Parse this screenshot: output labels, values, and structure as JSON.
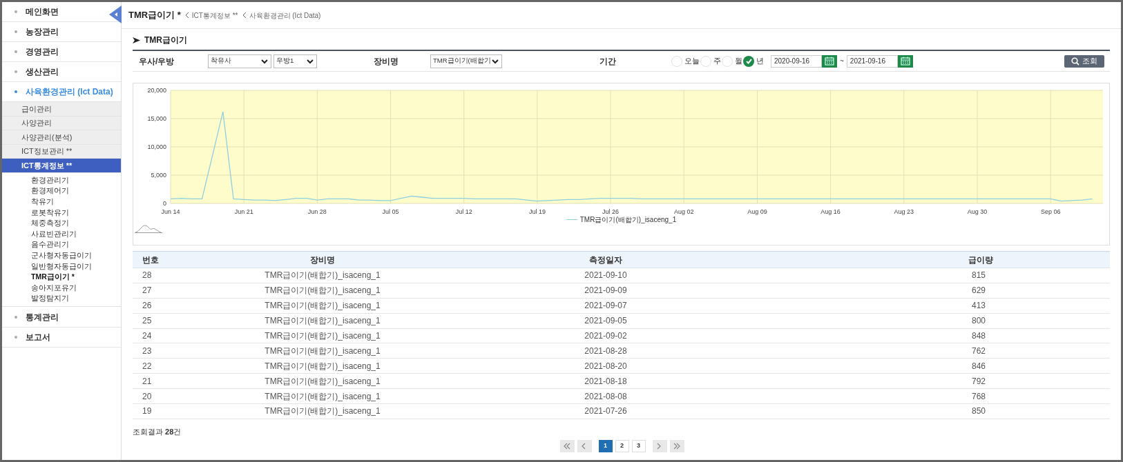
{
  "sidebar": {
    "items": [
      {
        "label": "메인화면",
        "selected": false
      },
      {
        "label": "농장관리",
        "selected": false
      },
      {
        "label": "경영관리",
        "selected": false
      },
      {
        "label": "생산관리",
        "selected": false
      },
      {
        "label": "사육환경관리 (Ict Data)",
        "selected": true,
        "children": [
          {
            "label": "급이관리",
            "selected": false
          },
          {
            "label": "사양관리",
            "selected": false
          },
          {
            "label": "사양관리(분석)",
            "selected": false
          },
          {
            "label": "ICT정보관리 **",
            "selected": false
          },
          {
            "label": "ICT통계정보 **",
            "selected": true,
            "children": [
              {
                "label": "환경관리기",
                "selected": false
              },
              {
                "label": "환경제어기",
                "selected": false
              },
              {
                "label": "착유기",
                "selected": false
              },
              {
                "label": "로봇착유기",
                "selected": false
              },
              {
                "label": "체중측정기",
                "selected": false
              },
              {
                "label": "사료빈관리기",
                "selected": false
              },
              {
                "label": "음수관리기",
                "selected": false
              },
              {
                "label": "군사형자동급이기",
                "selected": false
              },
              {
                "label": "일반형자동급이기",
                "selected": false
              },
              {
                "label": "TMR급이기 *",
                "selected": true
              },
              {
                "label": "송아지포유기",
                "selected": false
              },
              {
                "label": "발정탐지기",
                "selected": false
              }
            ]
          }
        ]
      },
      {
        "label": "통계관리",
        "selected": false
      },
      {
        "label": "보고서",
        "selected": false
      }
    ]
  },
  "header": {
    "title": "TMR급이기 *",
    "breadcrumb": [
      "ICT통계정보 **",
      "사육환경관리 (Ict Data)"
    ]
  },
  "section_title": "TMR급이기",
  "filters": {
    "barn_label": "우사/우방",
    "barn_select": "착유사",
    "room_select": "우방1",
    "device_label": "장비명",
    "device_select": "TMR급이기(배합기",
    "period_label": "기간",
    "period_options": [
      {
        "label": "오늘",
        "checked": false
      },
      {
        "label": "주",
        "checked": false
      },
      {
        "label": "월",
        "checked": false
      },
      {
        "label": "년",
        "checked": true
      }
    ],
    "date_from": "2020-09-16",
    "date_separator": "~",
    "date_to": "2021-09-16",
    "search_button": "조회"
  },
  "chart_data": {
    "type": "line",
    "categories": [
      "Jun 14",
      null,
      null,
      null,
      null,
      null,
      null,
      "Jun 21",
      null,
      null,
      null,
      null,
      null,
      null,
      "Jun 28",
      null,
      null,
      null,
      null,
      null,
      null,
      "Jul 05",
      null,
      null,
      null,
      null,
      null,
      null,
      "Jul 12",
      null,
      null,
      null,
      null,
      null,
      null,
      "Jul 19",
      null,
      null,
      null,
      null,
      null,
      null,
      "Jul 26",
      null,
      null,
      null,
      null,
      null,
      null,
      "Aug 02",
      null,
      null,
      null,
      null,
      null,
      null,
      "Aug 09",
      null,
      null,
      null,
      null,
      null,
      null,
      "Aug 16",
      null,
      null,
      null,
      null,
      null,
      null,
      "Aug 23",
      null,
      null,
      null,
      null,
      null,
      null,
      "Aug 30",
      null,
      null,
      null,
      null,
      null,
      null,
      "Sep 06",
      null,
      null,
      null,
      null
    ],
    "ylim": [
      0,
      20000
    ],
    "grid": true,
    "yticks": [
      {
        "value": 0,
        "label": "0"
      },
      {
        "value": 5000,
        "label": "5,000"
      },
      {
        "value": 10000,
        "label": "10,000"
      },
      {
        "value": 15000,
        "label": "15,000"
      },
      {
        "value": 20000,
        "label": "20,000"
      }
    ],
    "series": [
      {
        "name": "TMR급이기(배합기)_isaceng_1",
        "color": "#8ecfe0",
        "values": [
          800,
          900,
          800,
          800,
          8500,
          16200,
          800,
          700,
          600,
          600,
          500,
          700,
          900,
          900,
          600,
          800,
          800,
          800,
          600,
          600,
          500,
          500,
          900,
          1300,
          1100,
          900,
          900,
          900,
          900,
          800,
          800,
          800,
          800,
          800,
          600,
          400,
          500,
          600,
          700,
          700,
          800,
          900,
          900,
          900,
          900,
          800,
          800,
          800,
          800,
          800,
          800,
          800,
          800,
          800,
          800,
          800,
          800,
          800,
          800,
          800,
          800,
          800,
          800,
          800,
          800,
          800,
          800,
          800,
          800,
          800,
          800,
          800,
          800,
          800,
          800,
          800,
          800,
          800,
          800,
          800,
          800,
          800,
          800,
          800,
          800,
          400,
          500,
          600,
          800
        ]
      }
    ]
  },
  "table": {
    "columns": [
      "번호",
      "장비명",
      "측정일자",
      "급이량"
    ],
    "rows": [
      [
        "28",
        "TMR급이기(배합기)_isaceng_1",
        "2021-09-10",
        "815"
      ],
      [
        "27",
        "TMR급이기(배합기)_isaceng_1",
        "2021-09-09",
        "629"
      ],
      [
        "26",
        "TMR급이기(배합기)_isaceng_1",
        "2021-09-07",
        "413"
      ],
      [
        "25",
        "TMR급이기(배합기)_isaceng_1",
        "2021-09-05",
        "800"
      ],
      [
        "24",
        "TMR급이기(배합기)_isaceng_1",
        "2021-09-02",
        "848"
      ],
      [
        "23",
        "TMR급이기(배합기)_isaceng_1",
        "2021-08-28",
        "762"
      ],
      [
        "22",
        "TMR급이기(배합기)_isaceng_1",
        "2021-08-20",
        "846"
      ],
      [
        "21",
        "TMR급이기(배합기)_isaceng_1",
        "2021-08-18",
        "792"
      ],
      [
        "20",
        "TMR급이기(배합기)_isaceng_1",
        "2021-08-08",
        "768"
      ],
      [
        "19",
        "TMR급이기(배합기)_isaceng_1",
        "2021-07-26",
        "850"
      ]
    ]
  },
  "result_count": "조회결과 **28**건",
  "pagination": [
    {
      "kind": "first",
      "selected": false
    },
    {
      "kind": "prev",
      "selected": false
    },
    {
      "kind": "page",
      "label": "1",
      "selected": true
    },
    {
      "kind": "page",
      "label": "2",
      "selected": false
    },
    {
      "kind": "page",
      "label": "3",
      "selected": false
    },
    {
      "kind": "next",
      "selected": false
    },
    {
      "kind": "last",
      "selected": false
    }
  ]
}
